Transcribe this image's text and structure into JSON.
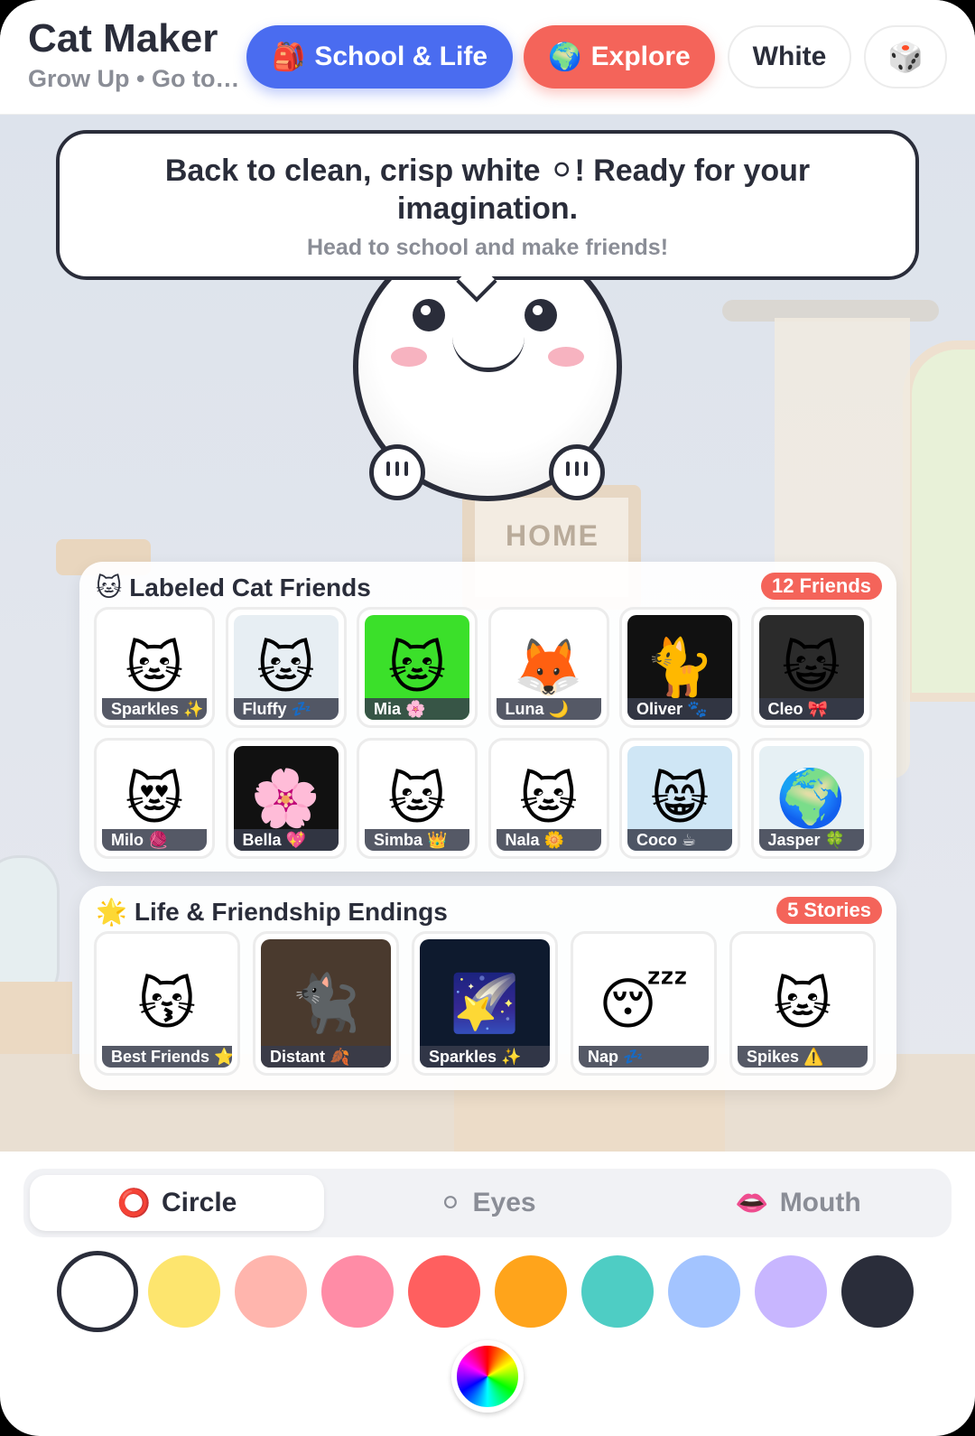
{
  "header": {
    "title": "Cat Maker",
    "subtitle": "Grow Up • Go to…",
    "school_button": {
      "icon": "🎒",
      "label": "School & Life"
    },
    "explore_button": {
      "icon": "🌍",
      "label": "Explore"
    },
    "color_button": {
      "label": "White"
    },
    "random_button": {
      "icon": "🎲"
    }
  },
  "scene": {
    "home_sign": "HOME"
  },
  "bubble": {
    "main": "Back to clean, crisp white ⚪! Ready for your imagination.",
    "sub": "Head to school and make friends!"
  },
  "friends": {
    "icon": "🐱",
    "title": "Labeled Cat Friends",
    "badge": "12 Friends",
    "items": [
      {
        "label": "Sparkles ✨",
        "thumb": "🐱",
        "bg": "#ffffff"
      },
      {
        "label": "Fluffy 💤",
        "thumb": "🐱",
        "bg": "#e7eef3"
      },
      {
        "label": "Mia 🌸",
        "thumb": "🐱",
        "bg": "#3be02a"
      },
      {
        "label": "Luna 🌙",
        "thumb": "🦊",
        "bg": "#ffffff"
      },
      {
        "label": "Oliver 🐾",
        "thumb": "🐈",
        "bg": "#111111"
      },
      {
        "label": "Cleo 🎀",
        "thumb": "😺",
        "bg": "#2b2b2b"
      },
      {
        "label": "Milo 🧶",
        "thumb": "😻",
        "bg": "#ffffff"
      },
      {
        "label": "Bella 💖",
        "thumb": "🌸",
        "bg": "#111111"
      },
      {
        "label": "Simba 👑",
        "thumb": "🐱",
        "bg": "#ffffff"
      },
      {
        "label": "Nala 🌼",
        "thumb": "🐱",
        "bg": "#ffffff"
      },
      {
        "label": "Coco ☕",
        "thumb": "😸",
        "bg": "#cfe6f5"
      },
      {
        "label": "Jasper 🍀",
        "thumb": "🌍",
        "bg": "#e6f0f4"
      }
    ]
  },
  "endings": {
    "icon": "🌟",
    "title": "Life & Friendship Endings",
    "badge": "5 Stories",
    "items": [
      {
        "label": "Best Friends ⭐",
        "thumb": "😽",
        "bg": "#ffffff"
      },
      {
        "label": "Distant 🍂",
        "thumb": "🐈‍⬛",
        "bg": "#4a3a2e"
      },
      {
        "label": "Sparkles ✨",
        "thumb": "🌠",
        "bg": "#0e1a2e"
      },
      {
        "label": "Nap 💤",
        "thumb": "😴",
        "bg": "#ffffff"
      },
      {
        "label": "Spikes ⚠️",
        "thumb": "🐱",
        "bg": "#ffffff"
      }
    ]
  },
  "tabs": [
    {
      "icon": "⭕",
      "label": "Circle"
    },
    {
      "icon": "⚪",
      "label": "Eyes"
    },
    {
      "icon": "👄",
      "label": "Mouth"
    }
  ],
  "colors": {
    "swatches": [
      "#ffffff",
      "#fde56e",
      "#ffb5ad",
      "#ff8ca6",
      "#ff5f5f",
      "#ffa41b",
      "#4ecdc4",
      "#a3c4ff",
      "#c8b6ff",
      "#2a2d3a"
    ],
    "selected": "#ffffff"
  }
}
